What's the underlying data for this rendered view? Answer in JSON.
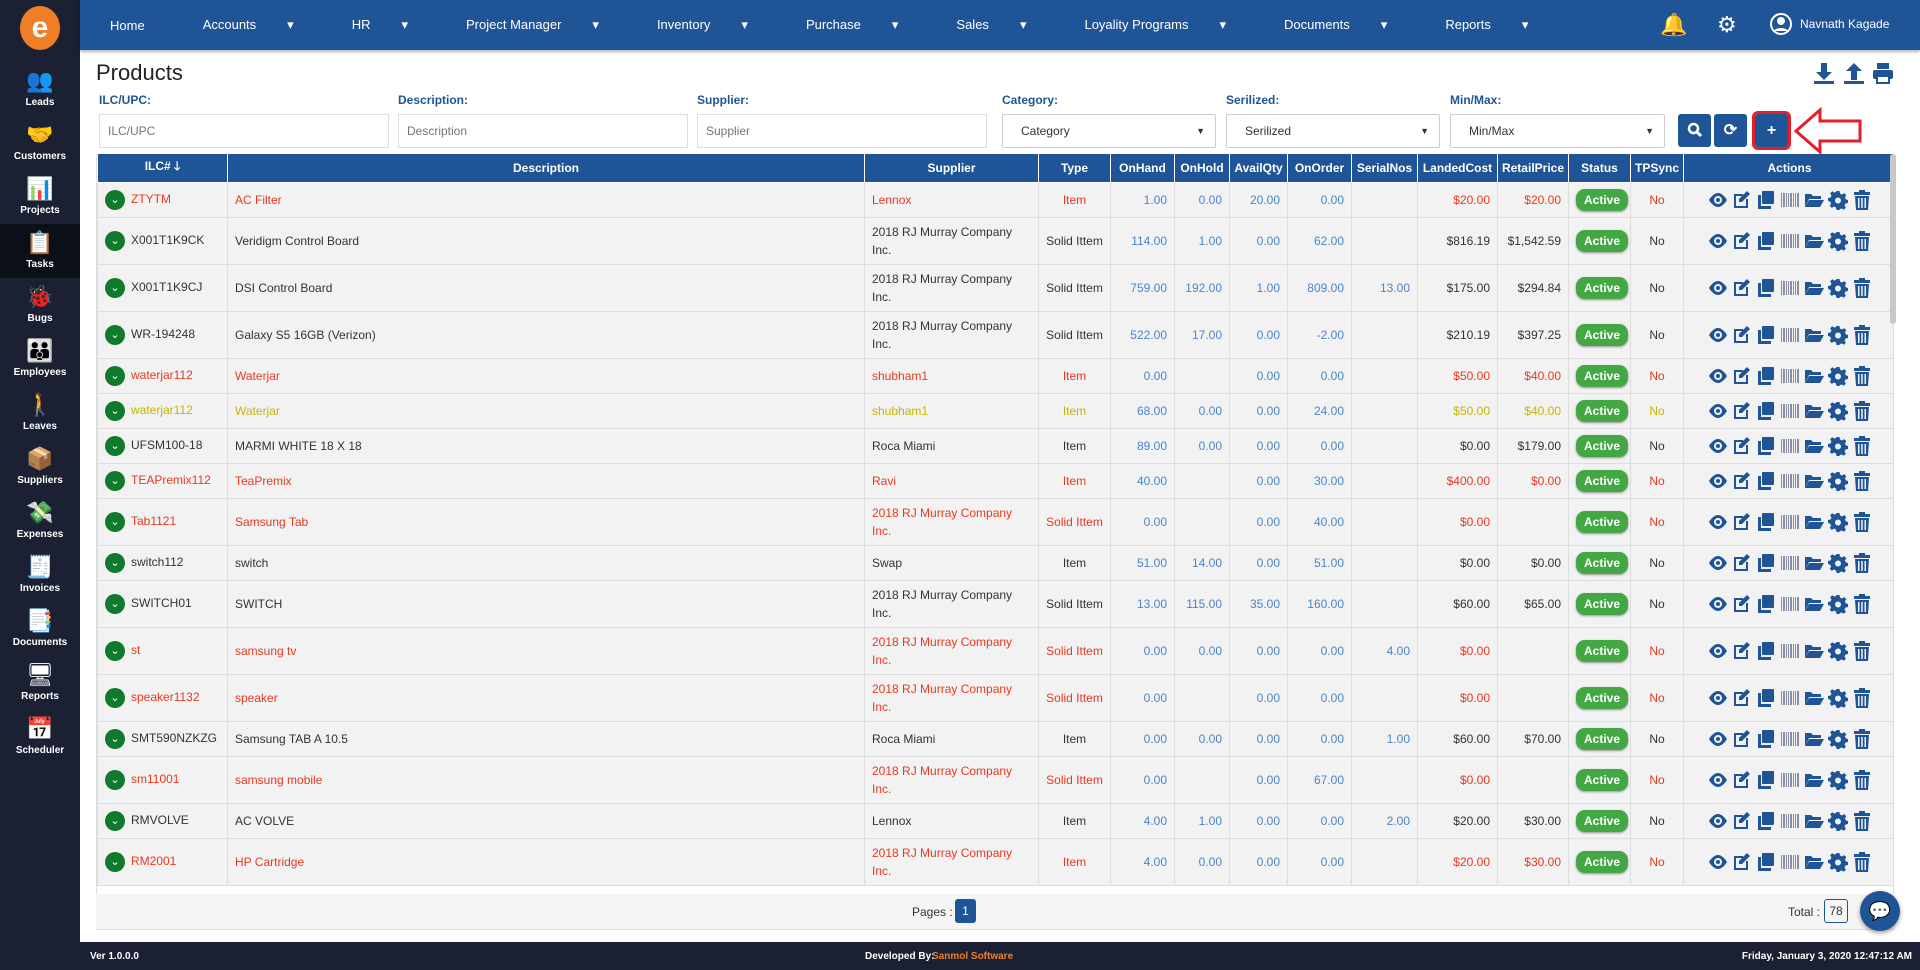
{
  "sidebar": {
    "logo": "e",
    "items": [
      {
        "label": "Leads",
        "icon": "leads-icon",
        "glyph": "👥"
      },
      {
        "label": "Customers",
        "icon": "handshake-icon",
        "glyph": "🤝"
      },
      {
        "label": "Projects",
        "icon": "projects-icon",
        "glyph": "📊"
      },
      {
        "label": "Tasks",
        "icon": "clipboard-icon",
        "glyph": "📋",
        "active": true
      },
      {
        "label": "Bugs",
        "icon": "bug-icon",
        "glyph": "🐞"
      },
      {
        "label": "Employees",
        "icon": "employees-icon",
        "glyph": "👪"
      },
      {
        "label": "Leaves",
        "icon": "traveler-icon",
        "glyph": "🚶"
      },
      {
        "label": "Suppliers",
        "icon": "supplier-icon",
        "glyph": "📦"
      },
      {
        "label": "Expenses",
        "icon": "expenses-icon",
        "glyph": "💸"
      },
      {
        "label": "Invoices",
        "icon": "invoice-icon",
        "glyph": "🧾"
      },
      {
        "label": "Documents",
        "icon": "documents-icon",
        "glyph": "📑"
      },
      {
        "label": "Reports",
        "icon": "reports-icon",
        "glyph": "🖥"
      },
      {
        "label": "Scheduler",
        "icon": "calendar-icon",
        "glyph": "📅"
      }
    ]
  },
  "nav": {
    "items": [
      {
        "label": "Home",
        "dropdown": false
      },
      {
        "label": "Accounts",
        "dropdown": true
      },
      {
        "label": "HR",
        "dropdown": true
      },
      {
        "label": "Project Manager",
        "dropdown": true
      },
      {
        "label": "Inventory",
        "dropdown": true
      },
      {
        "label": "Purchase",
        "dropdown": true
      },
      {
        "label": "Sales",
        "dropdown": true
      },
      {
        "label": "Loyality Programs",
        "dropdown": true
      },
      {
        "label": "Documents",
        "dropdown": true
      },
      {
        "label": "Reports",
        "dropdown": true
      }
    ],
    "user_name": "Navnath Kagade",
    "caret": "▾"
  },
  "page": {
    "title": "Products"
  },
  "filters": {
    "ilc": {
      "label": "ILC/UPC:",
      "placeholder": "ILC/UPC"
    },
    "description": {
      "label": "Description:",
      "placeholder": "Description"
    },
    "supplier": {
      "label": "Supplier:",
      "placeholder": "Supplier"
    },
    "category": {
      "label": "Category:",
      "value": "Category"
    },
    "serialized": {
      "label": "Serilized:",
      "value": "Serilized"
    },
    "minmax": {
      "label": "Min/Max:",
      "value": "Min/Max"
    }
  },
  "table": {
    "columns": [
      "ILC# 🡓",
      "Description",
      "Supplier",
      "Type",
      "OnHand",
      "OnHold",
      "AvailQty",
      "OnOrder",
      "SerialNos",
      "LandedCost",
      "RetailPrice",
      "Status",
      "TPSync",
      "Actions"
    ],
    "rows": [
      {
        "color": "red",
        "ilc": "ZTYTM",
        "desc": "AC Filter",
        "supplier": "Lennox",
        "type": "Item",
        "onhand": "1.00",
        "onhold": "0.00",
        "avail": "20.00",
        "onorder": "0.00",
        "serial": "",
        "landed": "$20.00",
        "retail": "$20.00",
        "status": "Active",
        "tpsync": "No"
      },
      {
        "color": "default",
        "ilc": "X001T1K9CK",
        "desc": "Veridigm Control Board",
        "supplier": "2018 RJ Murray Company Inc.",
        "type": "Solid Ittem",
        "onhand": "114.00",
        "onhold": "1.00",
        "avail": "0.00",
        "onorder": "62.00",
        "serial": "",
        "landed": "$816.19",
        "retail": "$1,542.59",
        "status": "Active",
        "tpsync": "No"
      },
      {
        "color": "default",
        "ilc": "X001T1K9CJ",
        "desc": "DSI Control Board",
        "supplier": "2018 RJ Murray Company Inc.",
        "type": "Solid Ittem",
        "onhand": "759.00",
        "onhold": "192.00",
        "avail": "1.00",
        "onorder": "809.00",
        "serial": "13.00",
        "landed": "$175.00",
        "retail": "$294.84",
        "status": "Active",
        "tpsync": "No"
      },
      {
        "color": "default",
        "ilc": "WR-194248",
        "desc": "Galaxy S5 16GB (Verizon)",
        "supplier": "2018 RJ Murray Company Inc.",
        "type": "Solid Ittem",
        "onhand": "522.00",
        "onhold": "17.00",
        "avail": "0.00",
        "onorder": "-2.00",
        "serial": "",
        "landed": "$210.19",
        "retail": "$397.25",
        "status": "Active",
        "tpsync": "No"
      },
      {
        "color": "red",
        "ilc": "waterjar112",
        "desc": "Waterjar",
        "supplier": "shubham1",
        "type": "Item",
        "onhand": "0.00",
        "onhold": "",
        "avail": "0.00",
        "onorder": "0.00",
        "serial": "",
        "landed": "$50.00",
        "retail": "$40.00",
        "status": "Active",
        "tpsync": "No"
      },
      {
        "color": "yellow",
        "ilc": "waterjar112",
        "desc": "Waterjar",
        "supplier": "shubham1",
        "type": "Item",
        "onhand": "68.00",
        "onhold": "0.00",
        "avail": "0.00",
        "onorder": "24.00",
        "serial": "",
        "landed": "$50.00",
        "retail": "$40.00",
        "status": "Active",
        "tpsync": "No"
      },
      {
        "color": "default",
        "ilc": "UFSM100-18",
        "desc": "MARMI WHITE 18 X 18",
        "supplier": "Roca Miami",
        "type": "Item",
        "onhand": "89.00",
        "onhold": "0.00",
        "avail": "0.00",
        "onorder": "0.00",
        "serial": "",
        "landed": "$0.00",
        "retail": "$179.00",
        "status": "Active",
        "tpsync": "No"
      },
      {
        "color": "red",
        "ilc": "TEAPremix112",
        "desc": "TeaPremix",
        "supplier": "Ravi",
        "type": "Item",
        "onhand": "40.00",
        "onhold": "",
        "avail": "0.00",
        "onorder": "30.00",
        "serial": "",
        "landed": "$400.00",
        "retail": "$0.00",
        "status": "Active",
        "tpsync": "No"
      },
      {
        "color": "red",
        "ilc": "Tab1121",
        "desc": "Samsung Tab",
        "supplier": "2018 RJ Murray Company Inc.",
        "type": "Solid Ittem",
        "onhand": "0.00",
        "onhold": "",
        "avail": "0.00",
        "onorder": "40.00",
        "serial": "",
        "landed": "$0.00",
        "retail": "",
        "status": "Active",
        "tpsync": "No"
      },
      {
        "color": "default",
        "ilc": "switch112",
        "desc": "switch",
        "supplier": "Swap",
        "type": "Item",
        "onhand": "51.00",
        "onhold": "14.00",
        "avail": "0.00",
        "onorder": "51.00",
        "serial": "",
        "landed": "$0.00",
        "retail": "$0.00",
        "status": "Active",
        "tpsync": "No"
      },
      {
        "color": "default",
        "ilc": "SWITCH01",
        "desc": "SWITCH",
        "supplier": "2018 RJ Murray Company Inc.",
        "type": "Solid Ittem",
        "onhand": "13.00",
        "onhold": "115.00",
        "avail": "35.00",
        "onorder": "160.00",
        "serial": "",
        "landed": "$60.00",
        "retail": "$65.00",
        "status": "Active",
        "tpsync": "No"
      },
      {
        "color": "red",
        "ilc": "st",
        "desc": "samsung tv",
        "supplier": "2018 RJ Murray Company Inc.",
        "type": "Solid Ittem",
        "onhand": "0.00",
        "onhold": "0.00",
        "avail": "0.00",
        "onorder": "0.00",
        "serial": "4.00",
        "landed": "$0.00",
        "retail": "",
        "status": "Active",
        "tpsync": "No"
      },
      {
        "color": "red",
        "ilc": "speaker1132",
        "desc": "speaker",
        "supplier": "2018 RJ Murray Company Inc.",
        "type": "Solid Ittem",
        "onhand": "0.00",
        "onhold": "",
        "avail": "0.00",
        "onorder": "0.00",
        "serial": "",
        "landed": "$0.00",
        "retail": "",
        "status": "Active",
        "tpsync": "No"
      },
      {
        "color": "default",
        "ilc": "SMT590NZKZG",
        "desc": "Samsung TAB A 10.5",
        "supplier": "Roca Miami",
        "type": "Item",
        "onhand": "0.00",
        "onhold": "0.00",
        "avail": "0.00",
        "onorder": "0.00",
        "serial": "1.00",
        "landed": "$60.00",
        "retail": "$70.00",
        "status": "Active",
        "tpsync": "No"
      },
      {
        "color": "red",
        "ilc": "sm11001",
        "desc": "samsung mobile",
        "supplier": "2018 RJ Murray Company Inc.",
        "type": "Solid Ittem",
        "onhand": "0.00",
        "onhold": "",
        "avail": "0.00",
        "onorder": "67.00",
        "serial": "",
        "landed": "$0.00",
        "retail": "",
        "status": "Active",
        "tpsync": "No"
      },
      {
        "color": "default",
        "ilc": "RMVOLVE",
        "desc": "AC VOLVE",
        "supplier": "Lennox",
        "type": "Item",
        "onhand": "4.00",
        "onhold": "1.00",
        "avail": "0.00",
        "onorder": "0.00",
        "serial": "2.00",
        "landed": "$20.00",
        "retail": "$30.00",
        "status": "Active",
        "tpsync": "No"
      },
      {
        "color": "red",
        "ilc": "RM2001",
        "desc": "HP Cartridge",
        "supplier": "2018 RJ Murray Company Inc.",
        "type": "Item",
        "onhand": "4.00",
        "onhold": "0.00",
        "avail": "0.00",
        "onorder": "0.00",
        "serial": "",
        "landed": "$20.00",
        "retail": "$30.00",
        "status": "Active",
        "tpsync": "No"
      }
    ]
  },
  "pager": {
    "pages_label": "Pages :",
    "current_page": "1",
    "total_label": "Total :",
    "total": "78"
  },
  "footer": {
    "version": "Ver 1.0.0.0",
    "developed_by": "Developed By:",
    "company": "Sanmol Software",
    "datetime": "Friday, January 3, 2020 12:47:12 AM"
  },
  "colors": {
    "primary": "#1f5497",
    "sidebar": "#1b2133",
    "red": "#e8391f",
    "yellow": "#c8b400",
    "number": "#4a86c8",
    "active": "#43a843",
    "highlight": "#e3202a"
  }
}
